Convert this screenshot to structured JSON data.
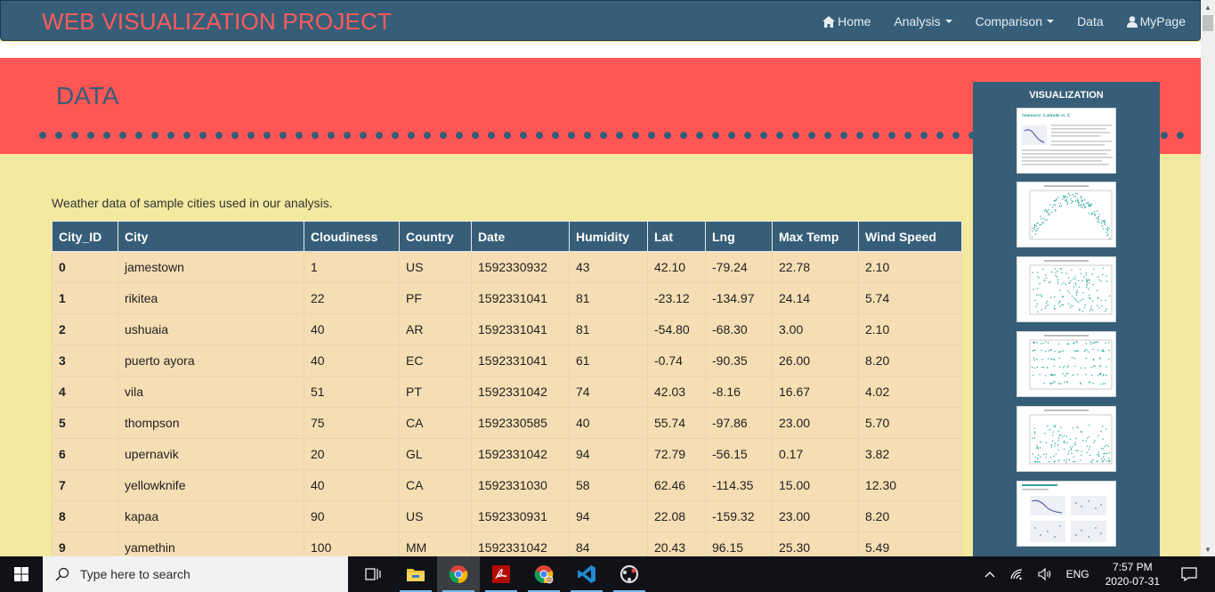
{
  "navbar": {
    "brand": "WEB VISUALIZATION PROJECT",
    "items": [
      {
        "label": "Home",
        "icon": "home-icon"
      },
      {
        "label": "Analysis",
        "dropdown": true
      },
      {
        "label": "Comparison",
        "dropdown": true
      },
      {
        "label": "Data"
      },
      {
        "label": "MyPage",
        "icon": "user-icon"
      }
    ]
  },
  "header": {
    "title": "DATA"
  },
  "main": {
    "intro": "Weather data of sample cities used in our analysis.",
    "table": {
      "columns": [
        "City_ID",
        "City",
        "Cloudiness",
        "Country",
        "Date",
        "Humidity",
        "Lat",
        "Lng",
        "Max Temp",
        "Wind Speed"
      ],
      "rows": [
        [
          "0",
          "jamestown",
          "1",
          "US",
          "1592330932",
          "43",
          "42.10",
          "-79.24",
          "22.78",
          "2.10"
        ],
        [
          "1",
          "rikitea",
          "22",
          "PF",
          "1592331041",
          "81",
          "-23.12",
          "-134.97",
          "24.14",
          "5.74"
        ],
        [
          "2",
          "ushuaia",
          "40",
          "AR",
          "1592331041",
          "81",
          "-54.80",
          "-68.30",
          "3.00",
          "2.10"
        ],
        [
          "3",
          "puerto ayora",
          "40",
          "EC",
          "1592331041",
          "61",
          "-0.74",
          "-90.35",
          "26.00",
          "8.20"
        ],
        [
          "4",
          "vila",
          "51",
          "PT",
          "1592331042",
          "74",
          "42.03",
          "-8.16",
          "16.67",
          "4.02"
        ],
        [
          "5",
          "thompson",
          "75",
          "CA",
          "1592330585",
          "40",
          "55.74",
          "-97.86",
          "23.00",
          "5.70"
        ],
        [
          "6",
          "upernavik",
          "20",
          "GL",
          "1592331042",
          "94",
          "72.79",
          "-56.15",
          "0.17",
          "3.82"
        ],
        [
          "7",
          "yellowknife",
          "40",
          "CA",
          "1592331030",
          "58",
          "62.46",
          "-114.35",
          "15.00",
          "12.30"
        ],
        [
          "8",
          "kapaa",
          "90",
          "US",
          "1592330931",
          "94",
          "22.08",
          "-159.32",
          "23.00",
          "8.20"
        ],
        [
          "9",
          "yamethin",
          "100",
          "MM",
          "1592331042",
          "84",
          "20.43",
          "96.15",
          "25.30",
          "5.49"
        ]
      ]
    }
  },
  "sidebar": {
    "title": "VISUALIZATION",
    "thumbnails": [
      {
        "heading": "Summary: Latitude vs. X"
      },
      {
        "heading": ""
      },
      {
        "heading": ""
      },
      {
        "heading": ""
      },
      {
        "heading": ""
      },
      {
        "heading": ""
      }
    ]
  },
  "taskbar": {
    "search_placeholder": "Type here to search",
    "apps": [
      "task-view-icon",
      "file-explorer-icon",
      "chrome-icon",
      "acrobat-icon",
      "chrome-profile-icon",
      "vscode-icon",
      "obs-icon"
    ],
    "language": "ENG",
    "time": "7:57 PM",
    "date": "2020-07-31"
  },
  "colors": {
    "navbar": "#375e78",
    "brand": "#ff5a5a",
    "band": "#ff5656",
    "page_bg": "#f3e99f",
    "cell_bg": "#f5deb3"
  }
}
